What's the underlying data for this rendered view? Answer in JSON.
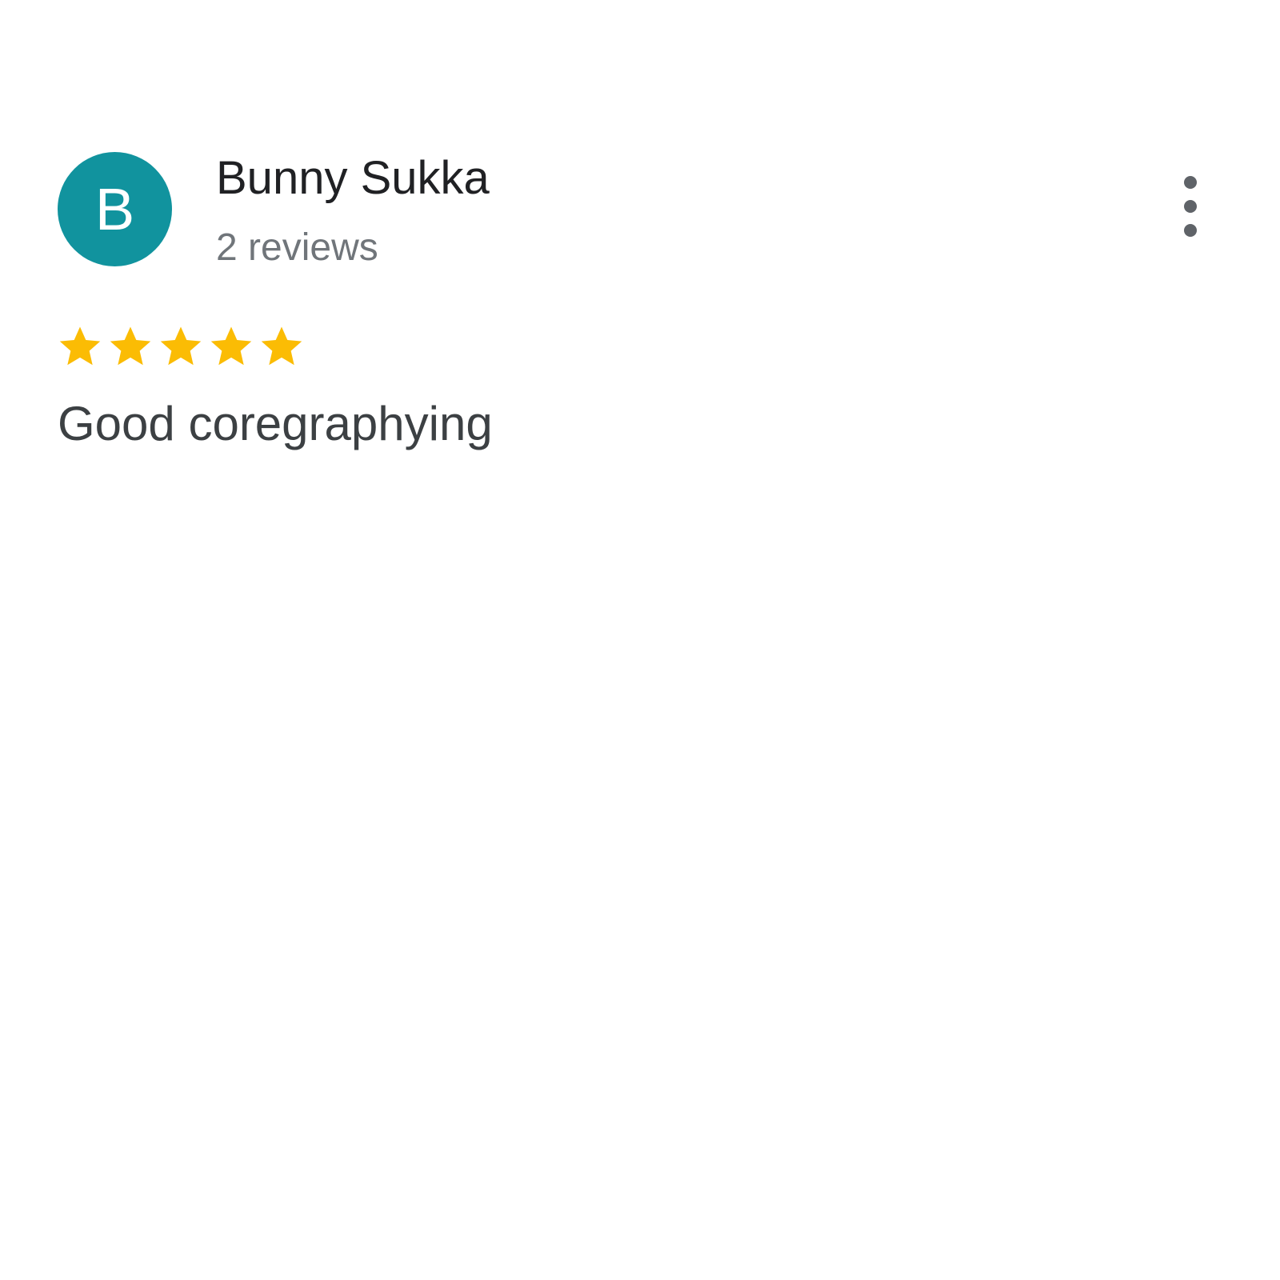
{
  "review": {
    "avatar_letter": "B",
    "avatar_color": "#11939e",
    "author_name": "Bunny Sukka",
    "review_count": "2 reviews",
    "rating": 5,
    "rating_max": 5,
    "star_color": "#fbbc04",
    "text": "Good coregraphying",
    "more_icon": "more-vert-icon"
  }
}
